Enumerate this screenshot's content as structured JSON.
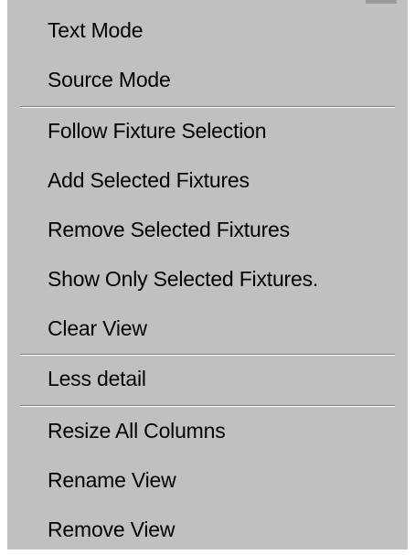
{
  "menu": {
    "items": [
      {
        "label": "Text Mode"
      },
      {
        "label": "Source Mode"
      },
      {
        "label": "Follow Fixture Selection"
      },
      {
        "label": "Add Selected Fixtures"
      },
      {
        "label": "Remove Selected Fixtures"
      },
      {
        "label": "Show Only Selected Fixtures."
      },
      {
        "label": "Clear View"
      },
      {
        "label": "Less detail"
      },
      {
        "label": "Resize All Columns"
      },
      {
        "label": "Rename View"
      },
      {
        "label": "Remove View"
      }
    ]
  },
  "colors": {
    "menu_background": "#c0c0c0",
    "separator_dark": "#7f7f7f",
    "separator_light": "#ffffff",
    "text": "#000000"
  }
}
